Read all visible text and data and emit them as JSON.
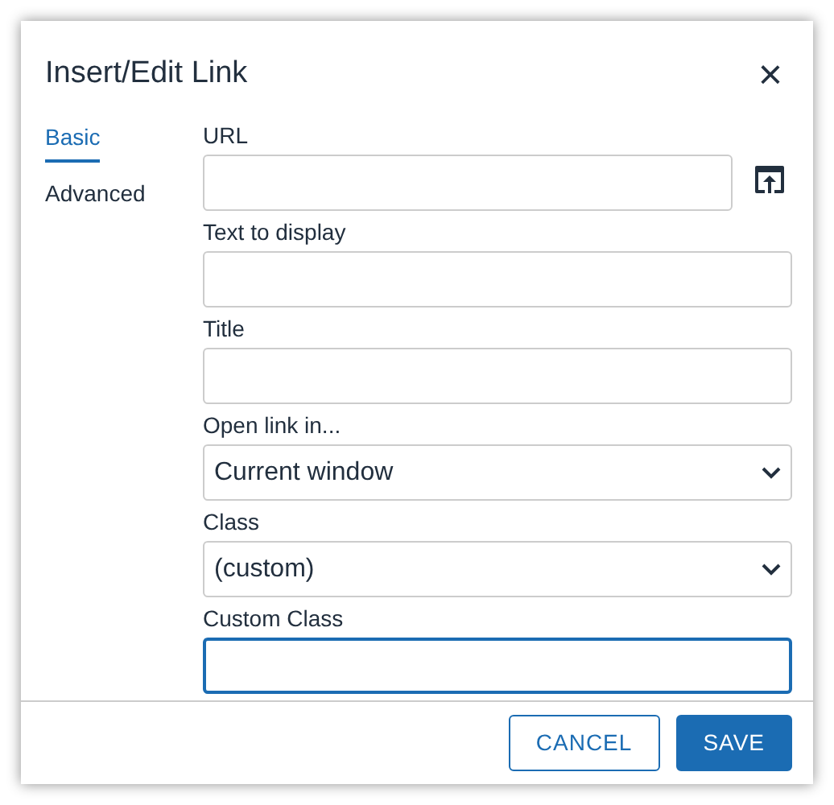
{
  "dialog": {
    "title": "Insert/Edit Link",
    "close": "×"
  },
  "tabs": [
    {
      "label": "Basic",
      "selected": true
    },
    {
      "label": "Advanced",
      "selected": false
    }
  ],
  "fields": [
    {
      "label": "URL",
      "kind": "text",
      "browse_button": true,
      "focused": false
    },
    {
      "label": "Text to display",
      "kind": "text",
      "focused": false
    },
    {
      "label": "Title",
      "kind": "text",
      "focused": false
    },
    {
      "label": "Open link in...",
      "kind": "select",
      "value": "Current window",
      "focused": false
    },
    {
      "label": "Class",
      "kind": "select",
      "value": "(custom)",
      "focused": false
    },
    {
      "label": "Custom Class",
      "kind": "text",
      "focused": true
    }
  ],
  "buttons": [
    {
      "label": "CANCEL",
      "kind": "secondary"
    },
    {
      "label": "SAVE",
      "kind": "primary"
    }
  ]
}
